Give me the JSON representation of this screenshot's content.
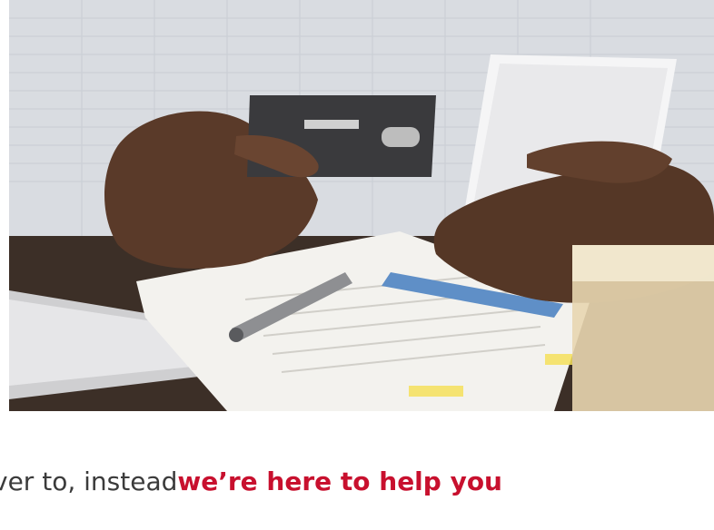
{
  "hero": {
    "description_icon": "photo-person-holding-card-and-phone"
  },
  "caption": {
    "lead": "ver to, instead ",
    "highlight": "we’re here to help you"
  },
  "colors": {
    "text": "#3b3b3b",
    "accent": "#c8102e"
  }
}
